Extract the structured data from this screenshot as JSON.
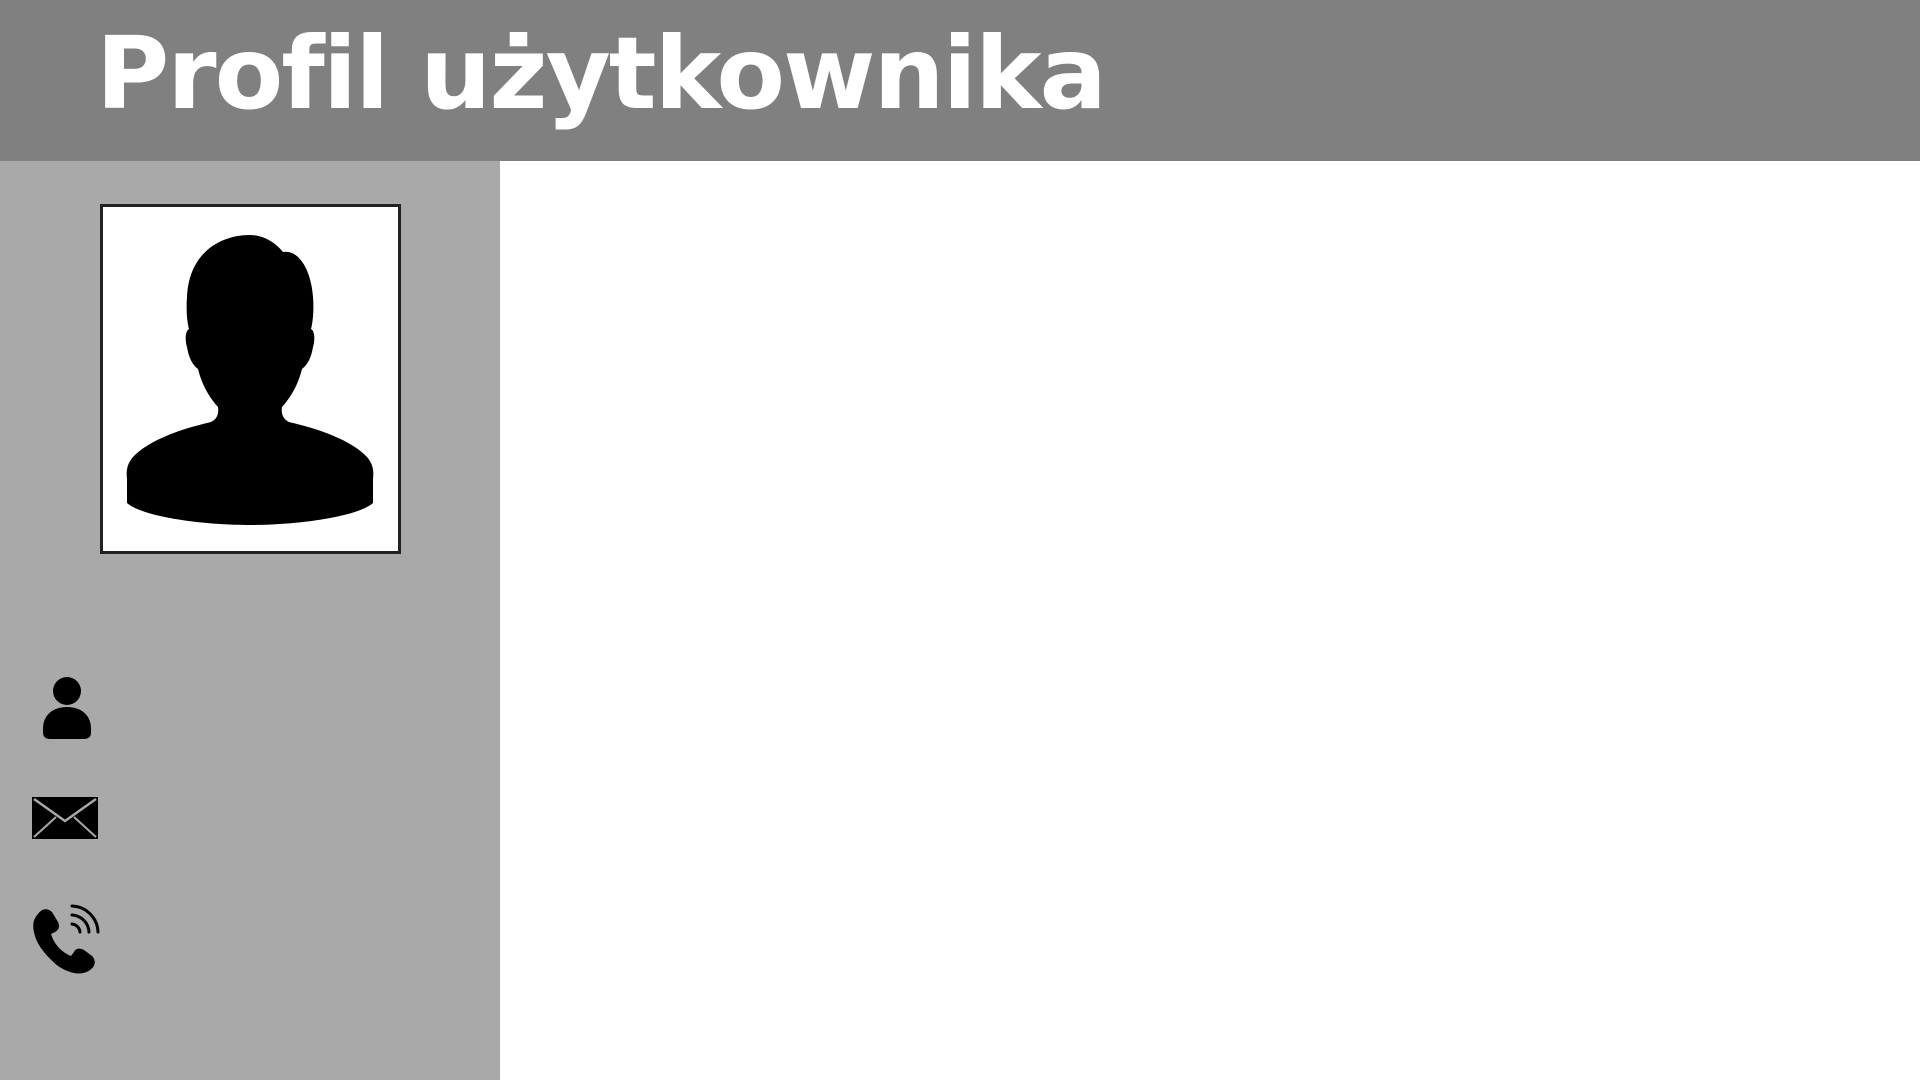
{
  "header": {
    "title": "Profil użytkownika",
    "background_color": "#808080"
  },
  "sidebar": {
    "background_color": "#a9a9a9",
    "avatar": {
      "icon": "user-silhouette-icon"
    },
    "contacts": [
      {
        "icon": "user-icon"
      },
      {
        "icon": "envelope-icon"
      },
      {
        "icon": "phone-icon"
      }
    ]
  },
  "main": {
    "background_color": "#ffffff"
  }
}
